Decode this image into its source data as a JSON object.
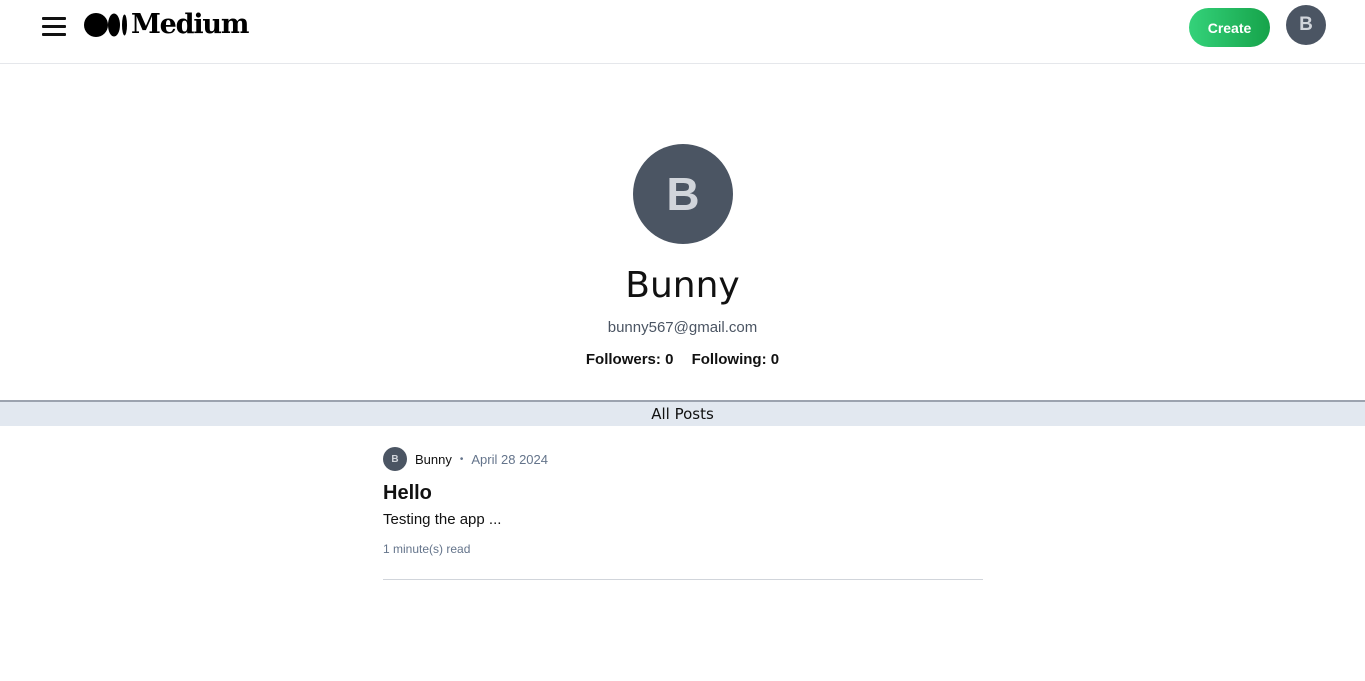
{
  "header": {
    "menu_icon": "hamburger-menu-icon",
    "logo_text": "Medium",
    "create_label": "Create",
    "avatar_initial": "B"
  },
  "profile": {
    "avatar_initial": "B",
    "name": "Bunny",
    "email": "bunny567@gmail.com",
    "followers_label": "Followers: 0",
    "following_label": "Following: 0"
  },
  "posts_section": {
    "heading": "All Posts",
    "posts": [
      {
        "avatar_initial": "B",
        "author": "Bunny",
        "separator": "•",
        "date": "April 28 2024",
        "title": "Hello",
        "excerpt": "Testing the app ...",
        "read_time": "1 minute(s) read"
      }
    ]
  },
  "colors": {
    "create_gradient_start": "#34d27a",
    "create_gradient_end": "#16a34a",
    "avatar_bg": "#4b5563",
    "avatar_text": "#d1d5db",
    "section_bar_bg": "#e2e8f0"
  }
}
